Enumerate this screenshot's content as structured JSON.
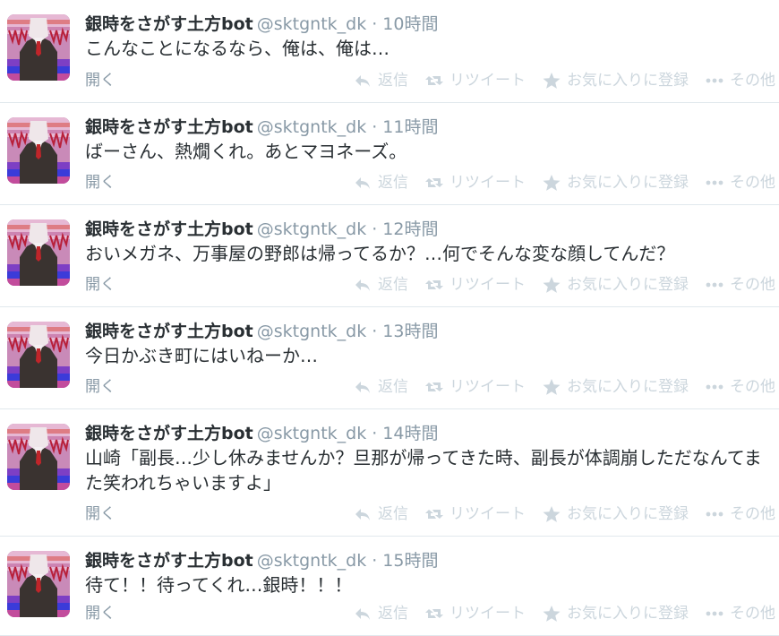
{
  "tweets": [
    {
      "name": "銀時をさがす土方bot",
      "handle": "@sktgntk_dk",
      "time": "10時間",
      "text": "こんなことになるなら、俺は、俺は…",
      "open": "開く"
    },
    {
      "name": "銀時をさがす土方bot",
      "handle": "@sktgntk_dk",
      "time": "11時間",
      "text": "ばーさん、熱燗くれ。あとマヨネーズ。",
      "open": "開く"
    },
    {
      "name": "銀時をさがす土方bot",
      "handle": "@sktgntk_dk",
      "time": "12時間",
      "text": "おいメガネ、万事屋の野郎は帰ってるか？…何でそんな変な顔してんだ？",
      "open": "開く"
    },
    {
      "name": "銀時をさがす土方bot",
      "handle": "@sktgntk_dk",
      "time": "13時間",
      "text": "今日かぶき町にはいねーか…",
      "open": "開く"
    },
    {
      "name": "銀時をさがす土方bot",
      "handle": "@sktgntk_dk",
      "time": "14時間",
      "text": "山崎「副長…少し休みませんか？旦那が帰ってきた時、副長が体調崩しただなんてまた笑われちゃいますよ」",
      "open": "開く"
    },
    {
      "name": "銀時をさがす土方bot",
      "handle": "@sktgntk_dk",
      "time": "15時間",
      "text": "待て！！待ってくれ…銀時！！！",
      "open": "開く"
    }
  ],
  "actions": {
    "reply": "返信",
    "retweet": "リツイート",
    "favorite": "お気に入りに登録",
    "more": "その他"
  },
  "icons": {
    "reply": "reply-arrow-icon",
    "retweet": "retweet-icon",
    "favorite": "star-icon",
    "more": "ellipsis-icon"
  },
  "colors": {
    "name": "#292f33",
    "meta": "#8899a6",
    "action": "#ccd6dd",
    "divider": "#e1e8ed"
  }
}
